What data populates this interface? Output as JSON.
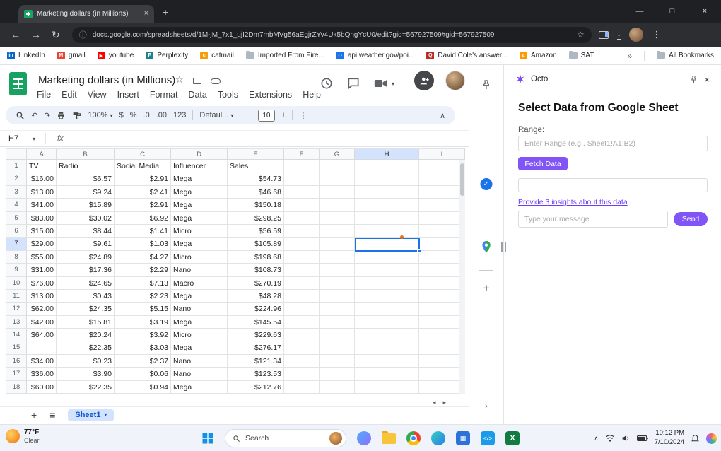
{
  "colors": {
    "accent_purple": "#8155f5",
    "selection_blue": "#1a73e8",
    "sheets_green": "#17a261",
    "header_highlight": "#d3e3fd"
  },
  "browser": {
    "tab_title": "Marketing dollars (in Millions)",
    "tab_close": "×",
    "new_tab": "+",
    "window_controls": {
      "minimize": "—",
      "maximize": "□",
      "close": "×"
    },
    "back": "←",
    "forward": "→",
    "reload": "↻",
    "url_info": "ⓘ",
    "url": "docs.google.com/spreadsheets/d/1M-jM_7x1_ujI2Dm7mbMVg56aEgjrZYv4Uk5bQngYcU0/edit?gid=567927509#gid=567927509",
    "url_star": "☆",
    "download": "↓",
    "menu_dots": "⋮",
    "bookmarks": [
      {
        "label": "LinkedIn",
        "color": "#0a66c2",
        "glyph": "in",
        "folder": false
      },
      {
        "label": "gmail",
        "color": "#ea4335",
        "glyph": "M",
        "folder": false
      },
      {
        "label": "youtube",
        "color": "#ff0000",
        "glyph": "▶",
        "folder": false
      },
      {
        "label": "Perplexity",
        "color": "#20808d",
        "glyph": "P",
        "folder": false
      },
      {
        "label": "catmail",
        "color": "#f59e0b",
        "glyph": "c",
        "folder": false
      },
      {
        "label": "Imported From Fire...",
        "color": "#aeb8c2",
        "glyph": "",
        "folder": true
      },
      {
        "label": "api.weather.gov/poi...",
        "color": "#1a73e8",
        "glyph": "◠",
        "folder": false
      },
      {
        "label": "David Cole's answer...",
        "color": "#b92b27",
        "glyph": "Q",
        "folder": false
      },
      {
        "label": "Amazon",
        "color": "#ff9900",
        "glyph": "a",
        "folder": false
      },
      {
        "label": "SAT",
        "color": "#aeb8c2",
        "glyph": "",
        "folder": true
      }
    ],
    "overflow_chevron": "»",
    "all_bookmarks": "All Bookmarks"
  },
  "sheets": {
    "title": "Marketing dollars (in Millions)",
    "star": "☆",
    "menus": [
      "File",
      "Edit",
      "View",
      "Insert",
      "Format",
      "Data",
      "Tools",
      "Extensions",
      "Help"
    ],
    "toolbar": {
      "undo": "↶",
      "redo": "↷",
      "zoom": "100%",
      "caret": "▾",
      "currency": "$",
      "percent": "%",
      "decrease_decimal": ".0",
      "increase_decimal": ".00",
      "format_123": "123",
      "font": "Defaul...",
      "minus": "−",
      "font_size": "10",
      "plus": "+",
      "more": "⋮",
      "collapse": "∧"
    },
    "name_box": "H7",
    "name_caret": "▾",
    "fx": "fx",
    "col_letters": [
      "A",
      "B",
      "C",
      "D",
      "E",
      "F",
      "G",
      "H",
      "I"
    ],
    "selected_col": "H",
    "selected_row": 7,
    "grid": {
      "headers": [
        "TV",
        "Radio",
        "Social Media",
        "Influencer",
        "Sales"
      ],
      "rows": [
        [
          "$16.00",
          "$6.57",
          "$2.91",
          "Mega",
          "$54.73"
        ],
        [
          "$13.00",
          "$9.24",
          "$2.41",
          "Mega",
          "$46.68"
        ],
        [
          "$41.00",
          "$15.89",
          "$2.91",
          "Mega",
          "$150.18"
        ],
        [
          "$83.00",
          "$30.02",
          "$6.92",
          "Mega",
          "$298.25"
        ],
        [
          "$15.00",
          "$8.44",
          "$1.41",
          "Micro",
          "$56.59"
        ],
        [
          "$29.00",
          "$9.61",
          "$1.03",
          "Mega",
          "$105.89"
        ],
        [
          "$55.00",
          "$24.89",
          "$4.27",
          "Micro",
          "$198.68"
        ],
        [
          "$31.00",
          "$17.36",
          "$2.29",
          "Nano",
          "$108.73"
        ],
        [
          "$76.00",
          "$24.65",
          "$7.13",
          "Macro",
          "$270.19"
        ],
        [
          "$13.00",
          "$0.43",
          "$2.23",
          "Mega",
          "$48.28"
        ],
        [
          "$62.00",
          "$24.35",
          "$5.15",
          "Nano",
          "$224.96"
        ],
        [
          "$42.00",
          "$15.81",
          "$3.19",
          "Mega",
          "$145.54"
        ],
        [
          "$64.00",
          "$20.24",
          "$3.92",
          "Micro",
          "$229.63"
        ],
        [
          "",
          "$22.35",
          "$3.03",
          "Mega",
          "$276.17"
        ],
        [
          "$34.00",
          "$0.23",
          "$2.37",
          "Nano",
          "$121.34"
        ],
        [
          "$36.00",
          "$3.90",
          "$0.06",
          "Nano",
          "$123.53"
        ],
        [
          "$60.00",
          "$22.35",
          "$0.94",
          "Mega",
          "$212.76"
        ]
      ]
    },
    "scroll_left": "◂",
    "scroll_right": "▸",
    "add_sheet": "+",
    "all_sheets": "≡",
    "sheet_tab": "Sheet1",
    "sheet_tab_caret": "▾",
    "rail_chevron": "›"
  },
  "octo": {
    "app_name": "Octo",
    "close": "×",
    "heading": "Select Data from Google Sheet",
    "range_label": "Range:",
    "range_placeholder": "Enter Range (e.g., Sheet1!A1:B2)",
    "fetch_button": "Fetch Data",
    "insights_link": "Provide 3 insights about this data",
    "message_placeholder": "Type your message",
    "send_button": "Send"
  },
  "taskbar": {
    "weather_temp": "77°F",
    "weather_desc": "Clear",
    "search_placeholder": "Search",
    "tray_chevron": "∧",
    "time": "10:12 PM",
    "date": "7/10/2024",
    "vscode_glyph": "</>",
    "excel_glyph": "X"
  }
}
